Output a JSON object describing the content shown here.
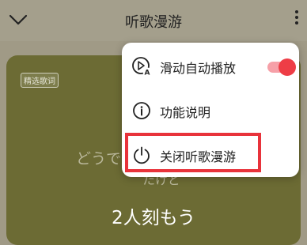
{
  "header": {
    "title": "听歌漫游",
    "back_icon": "chevron-down-icon",
    "more_icon": "more-vertical-icon"
  },
  "card": {
    "tag": "精选歌词",
    "lyrics": [
      "どうで",
      "たけど",
      "2人刻もう"
    ]
  },
  "menu": {
    "items": [
      {
        "label": "滑动自动播放",
        "icon": "autoplay-icon",
        "toggle_on": true
      },
      {
        "label": "功能说明",
        "icon": "info-icon"
      },
      {
        "label": "关闭听歌漫游",
        "icon": "power-icon"
      }
    ]
  },
  "colors": {
    "toggle_on": "#ee3d46",
    "highlight": "#e8333b",
    "card_bg": "#6c6b34"
  }
}
